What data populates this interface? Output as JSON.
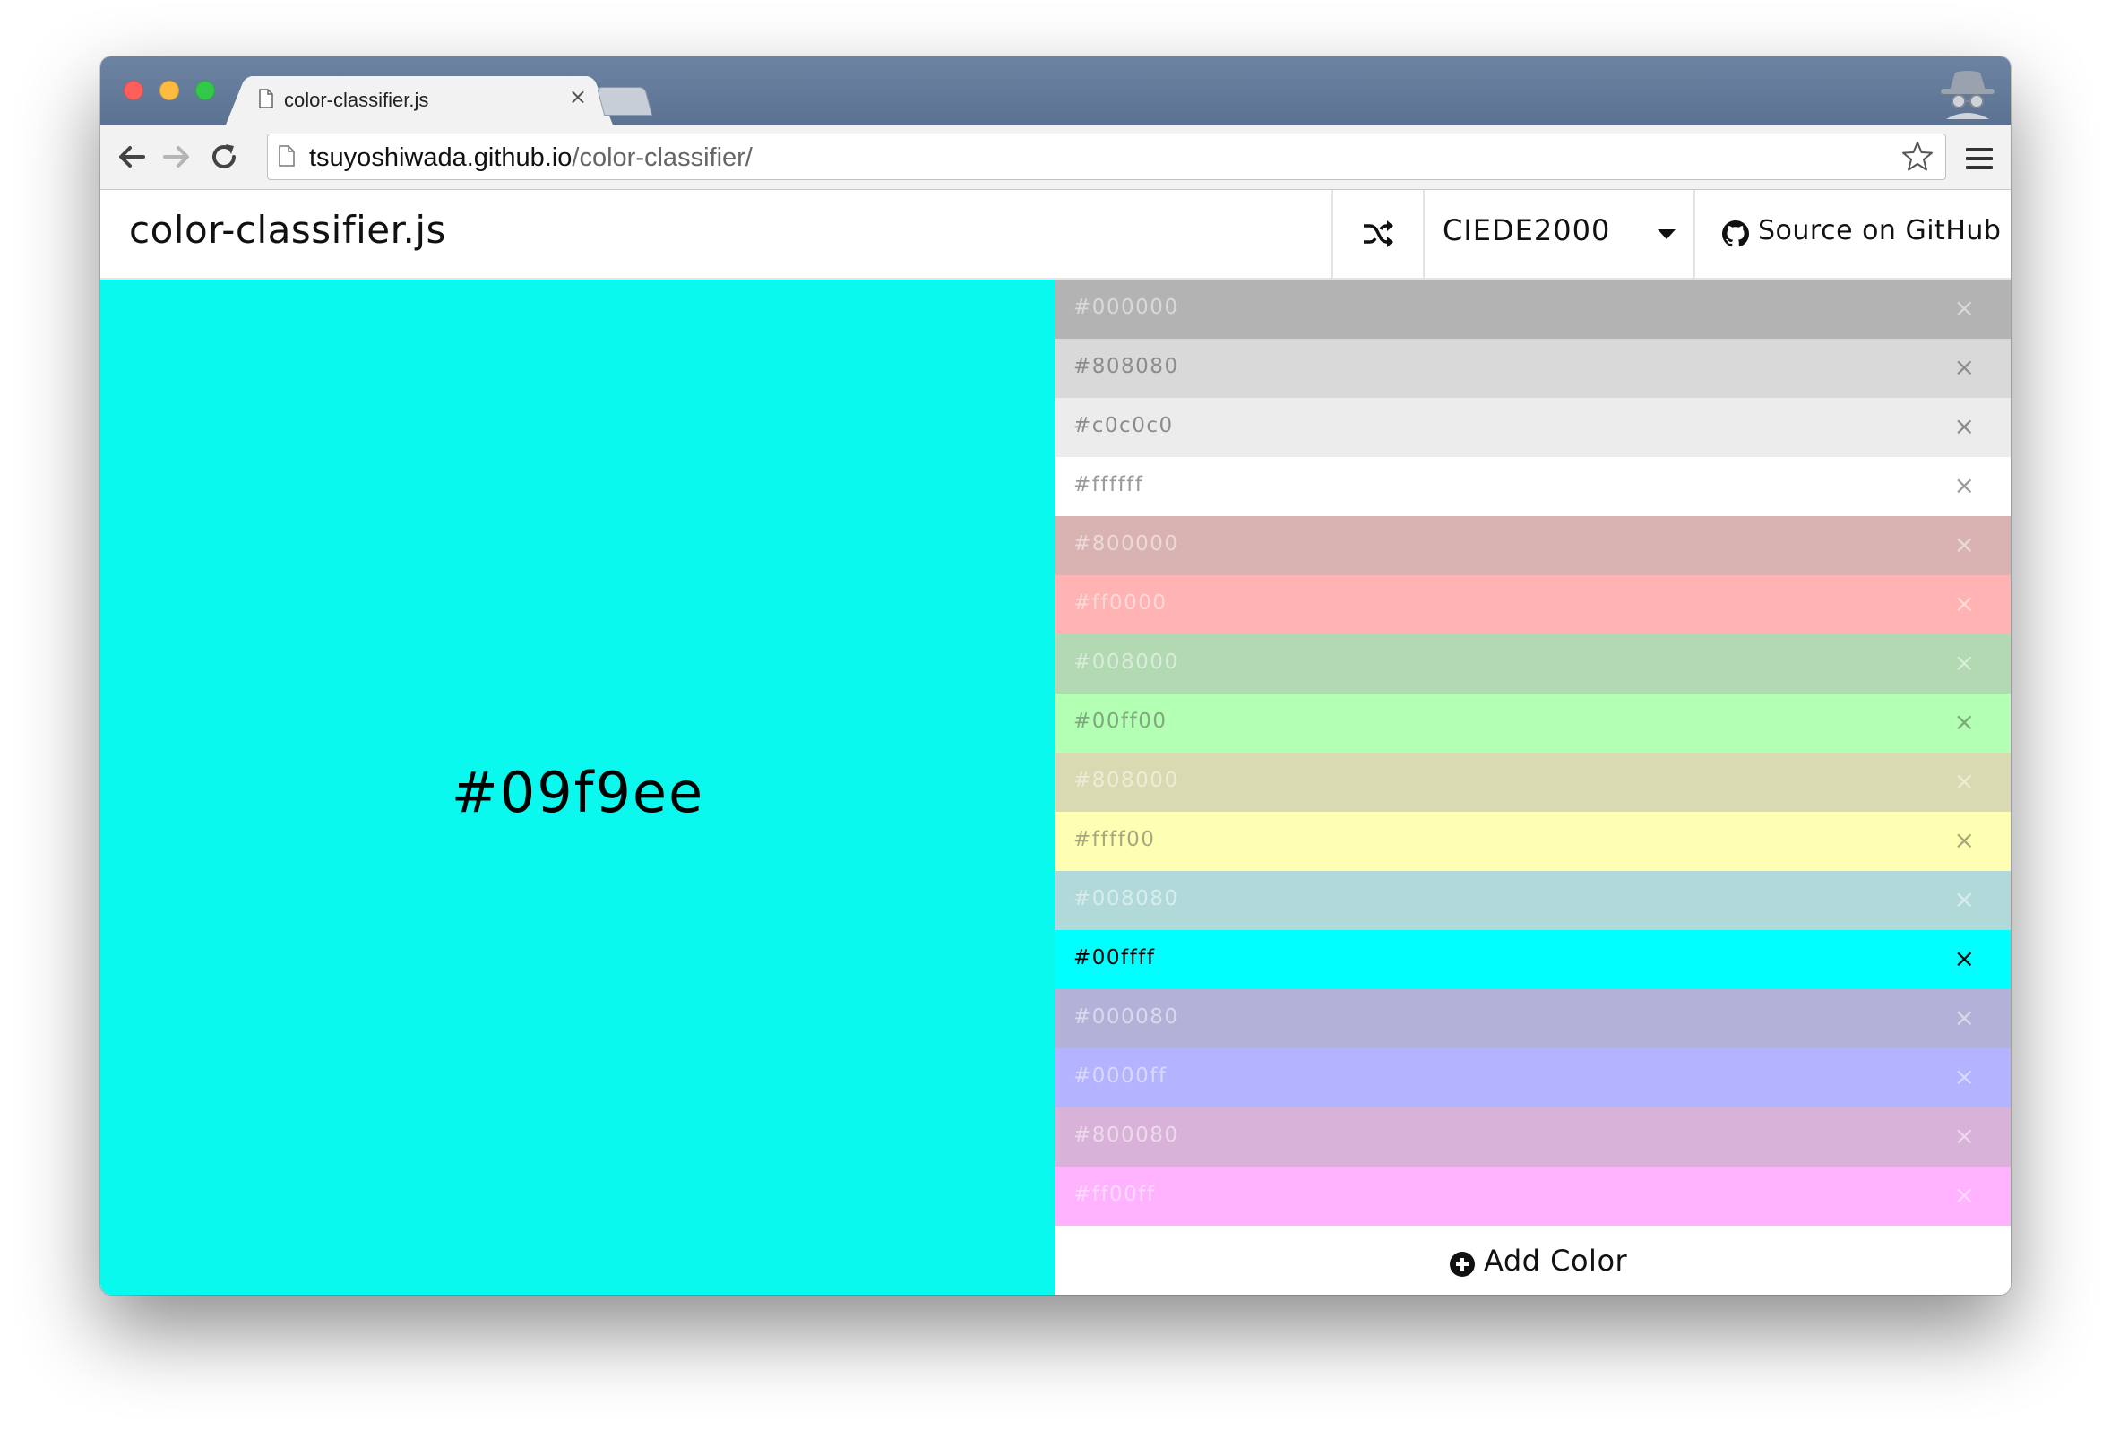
{
  "browser": {
    "tab_title": "color-classifier.js",
    "tab_close": "×",
    "url_host": "tsuyoshiwada.github.io",
    "url_path": "/color-classifier/"
  },
  "navbar": {
    "brand": "color-classifier.js",
    "metric": "CIEDE2000",
    "github_label": "Source on GitHub"
  },
  "preview": {
    "hex": "#09f9ee",
    "color": "#09f9ee"
  },
  "palette": [
    {
      "hex": "#000000",
      "bg": "#b3b3b3",
      "text": "#d9d9d9",
      "active": false
    },
    {
      "hex": "#808080",
      "bg": "#d9d9d9",
      "text": "#8c8c8c",
      "active": false
    },
    {
      "hex": "#c0c0c0",
      "bg": "#ececec",
      "text": "#8c8c8c",
      "active": false
    },
    {
      "hex": "#ffffff",
      "bg": "#ffffff",
      "text": "#9a9a9a",
      "active": false
    },
    {
      "hex": "#800000",
      "bg": "#d9b2b2",
      "text": "#ecd9d9",
      "active": false
    },
    {
      "hex": "#ff0000",
      "bg": "#ffb3b3",
      "text": "#ffd9d9",
      "active": false
    },
    {
      "hex": "#008000",
      "bg": "#b2d9b2",
      "text": "#d9ecd9",
      "active": false
    },
    {
      "hex": "#00ff00",
      "bg": "#b3ffb3",
      "text": "#7fa87f",
      "active": false
    },
    {
      "hex": "#808000",
      "bg": "#d9d9b2",
      "text": "#ececd9",
      "active": false
    },
    {
      "hex": "#ffff00",
      "bg": "#ffffb3",
      "text": "#a8a87f",
      "active": false
    },
    {
      "hex": "#008080",
      "bg": "#b2d9d9",
      "text": "#d9ecec",
      "active": false
    },
    {
      "hex": "#00ffff",
      "bg": "#00ffff",
      "text": "#000000",
      "active": true
    },
    {
      "hex": "#000080",
      "bg": "#b2b2d9",
      "text": "#d9d9ec",
      "active": false
    },
    {
      "hex": "#0000ff",
      "bg": "#b3b3ff",
      "text": "#d9d9ff",
      "active": false
    },
    {
      "hex": "#800080",
      "bg": "#d9b2d9",
      "text": "#ecd9ec",
      "active": false
    },
    {
      "hex": "#ff00ff",
      "bg": "#ffb3ff",
      "text": "#ffd9ff",
      "active": false
    }
  ],
  "remove_glyph": "×",
  "add_color_label": "Add Color"
}
